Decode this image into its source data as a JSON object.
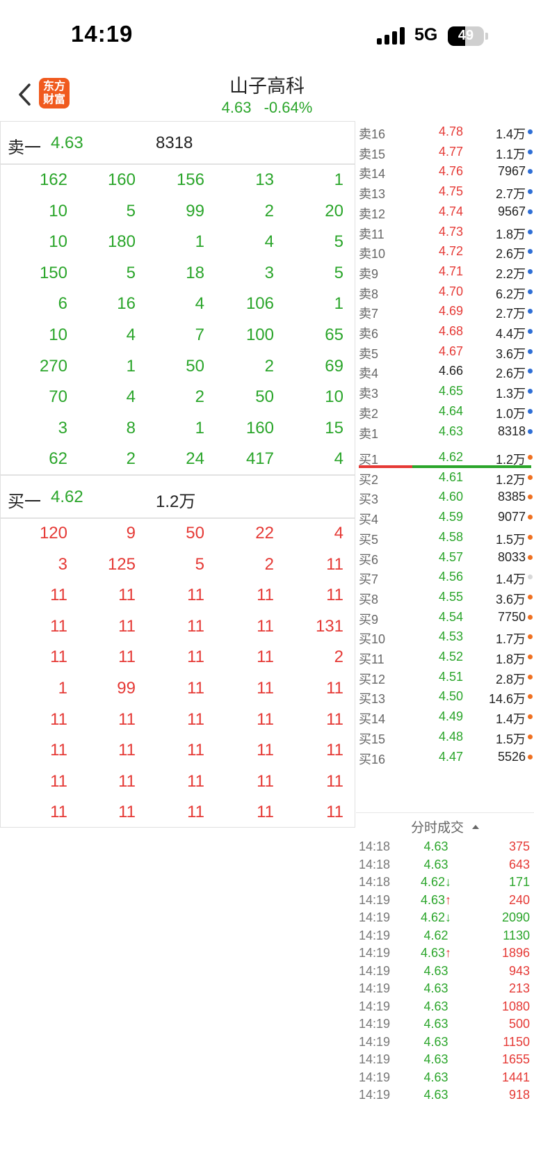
{
  "status_bar": {
    "time": "14:19",
    "network": "5G",
    "battery": "49",
    "battery_level": 0.49
  },
  "header": {
    "title": "山子高科",
    "price": "4.63",
    "change_pct": "-0.64%",
    "logo_line1": "东方",
    "logo_line2": "财富"
  },
  "left_panel": {
    "sell_level": {
      "label": "卖一",
      "price": "4.63",
      "volume": "8318"
    },
    "sell_queue": [
      [
        "162",
        "160",
        "156",
        "13",
        "1"
      ],
      [
        "10",
        "5",
        "99",
        "2",
        "20"
      ],
      [
        "10",
        "180",
        "1",
        "4",
        "5"
      ],
      [
        "150",
        "5",
        "18",
        "3",
        "5"
      ],
      [
        "6",
        "16",
        "4",
        "106",
        "1"
      ],
      [
        "10",
        "4",
        "7",
        "100",
        "65"
      ],
      [
        "270",
        "1",
        "50",
        "2",
        "69"
      ],
      [
        "70",
        "4",
        "2",
        "50",
        "10"
      ],
      [
        "3",
        "8",
        "1",
        "160",
        "15"
      ],
      [
        "62",
        "2",
        "24",
        "417",
        "4"
      ]
    ],
    "buy_level": {
      "label": "买一",
      "price": "4.62",
      "volume": "1.2万"
    },
    "buy_queue": [
      [
        "120",
        "9",
        "50",
        "22",
        "4"
      ],
      [
        "3",
        "125",
        "5",
        "2",
        "11"
      ],
      [
        "11",
        "11",
        "11",
        "11",
        "11"
      ],
      [
        "11",
        "11",
        "11",
        "11",
        "131"
      ],
      [
        "11",
        "11",
        "11",
        "11",
        "2"
      ],
      [
        "1",
        "99",
        "11",
        "11",
        "11"
      ],
      [
        "11",
        "11",
        "11",
        "11",
        "11"
      ],
      [
        "11",
        "11",
        "11",
        "11",
        "11"
      ],
      [
        "11",
        "11",
        "11",
        "11",
        "11"
      ],
      [
        "11",
        "11",
        "11",
        "11",
        "11"
      ]
    ]
  },
  "order_book": {
    "asks": [
      {
        "label": "卖16",
        "price": "4.78",
        "vol": "1.4万",
        "color": "red"
      },
      {
        "label": "卖15",
        "price": "4.77",
        "vol": "1.1万",
        "color": "red"
      },
      {
        "label": "卖14",
        "price": "4.76",
        "vol": "7967",
        "color": "red"
      },
      {
        "label": "卖13",
        "price": "4.75",
        "vol": "2.7万",
        "color": "red"
      },
      {
        "label": "卖12",
        "price": "4.74",
        "vol": "9567",
        "color": "red"
      },
      {
        "label": "卖11",
        "price": "4.73",
        "vol": "1.8万",
        "color": "red"
      },
      {
        "label": "卖10",
        "price": "4.72",
        "vol": "2.6万",
        "color": "red"
      },
      {
        "label": "卖9",
        "price": "4.71",
        "vol": "2.2万",
        "color": "red"
      },
      {
        "label": "卖8",
        "price": "4.70",
        "vol": "6.2万",
        "color": "red"
      },
      {
        "label": "卖7",
        "price": "4.69",
        "vol": "2.7万",
        "color": "red"
      },
      {
        "label": "卖6",
        "price": "4.68",
        "vol": "4.4万",
        "color": "red"
      },
      {
        "label": "卖5",
        "price": "4.67",
        "vol": "3.6万",
        "color": "red"
      },
      {
        "label": "卖4",
        "price": "4.66",
        "vol": "2.6万",
        "color": "dark"
      },
      {
        "label": "卖3",
        "price": "4.65",
        "vol": "1.3万",
        "color": "green"
      },
      {
        "label": "卖2",
        "price": "4.64",
        "vol": "1.0万",
        "color": "green"
      },
      {
        "label": "卖1",
        "price": "4.63",
        "vol": "8318",
        "color": "green"
      }
    ],
    "bids": [
      {
        "label": "买1",
        "price": "4.62",
        "vol": "1.2万",
        "dot": "orange"
      },
      {
        "label": "买2",
        "price": "4.61",
        "vol": "1.2万",
        "dot": "orange"
      },
      {
        "label": "买3",
        "price": "4.60",
        "vol": "8385",
        "dot": "orange"
      },
      {
        "label": "买4",
        "price": "4.59",
        "vol": "9077",
        "dot": "orange"
      },
      {
        "label": "买5",
        "price": "4.58",
        "vol": "1.5万",
        "dot": "orange"
      },
      {
        "label": "买6",
        "price": "4.57",
        "vol": "8033",
        "dot": "orange"
      },
      {
        "label": "买7",
        "price": "4.56",
        "vol": "1.4万",
        "dot": "light"
      },
      {
        "label": "买8",
        "price": "4.55",
        "vol": "3.6万",
        "dot": "orange"
      },
      {
        "label": "买9",
        "price": "4.54",
        "vol": "7750",
        "dot": "orange"
      },
      {
        "label": "买10",
        "price": "4.53",
        "vol": "1.7万",
        "dot": "orange"
      },
      {
        "label": "买11",
        "price": "4.52",
        "vol": "1.8万",
        "dot": "orange"
      },
      {
        "label": "买12",
        "price": "4.51",
        "vol": "2.8万",
        "dot": "orange"
      },
      {
        "label": "买13",
        "price": "4.50",
        "vol": "14.6万",
        "dot": "orange"
      },
      {
        "label": "买14",
        "price": "4.49",
        "vol": "1.4万",
        "dot": "orange"
      },
      {
        "label": "买15",
        "price": "4.48",
        "vol": "1.5万",
        "dot": "orange"
      },
      {
        "label": "买16",
        "price": "4.47",
        "vol": "5526",
        "dot": "orange"
      }
    ],
    "balance_red_fraction": 0.31
  },
  "ticks": {
    "header": "分时成交",
    "rows": [
      {
        "time": "14:18",
        "price": "4.63",
        "arrow": "",
        "vol": "375",
        "vol_color": "red"
      },
      {
        "time": "14:18",
        "price": "4.63",
        "arrow": "",
        "vol": "643",
        "vol_color": "red"
      },
      {
        "time": "14:18",
        "price": "4.62",
        "arrow": "↓",
        "vol": "171",
        "vol_color": "green"
      },
      {
        "time": "14:19",
        "price": "4.63",
        "arrow": "↑",
        "vol": "240",
        "vol_color": "red"
      },
      {
        "time": "14:19",
        "price": "4.62",
        "arrow": "↓",
        "vol": "2090",
        "vol_color": "green"
      },
      {
        "time": "14:19",
        "price": "4.62",
        "arrow": "",
        "vol": "1130",
        "vol_color": "green"
      },
      {
        "time": "14:19",
        "price": "4.63",
        "arrow": "↑",
        "vol": "1896",
        "vol_color": "red"
      },
      {
        "time": "14:19",
        "price": "4.63",
        "arrow": "",
        "vol": "943",
        "vol_color": "red"
      },
      {
        "time": "14:19",
        "price": "4.63",
        "arrow": "",
        "vol": "213",
        "vol_color": "red"
      },
      {
        "time": "14:19",
        "price": "4.63",
        "arrow": "",
        "vol": "1080",
        "vol_color": "red"
      },
      {
        "time": "14:19",
        "price": "4.63",
        "arrow": "",
        "vol": "500",
        "vol_color": "red"
      },
      {
        "time": "14:19",
        "price": "4.63",
        "arrow": "",
        "vol": "1150",
        "vol_color": "red"
      },
      {
        "time": "14:19",
        "price": "4.63",
        "arrow": "",
        "vol": "1655",
        "vol_color": "red"
      },
      {
        "time": "14:19",
        "price": "4.63",
        "arrow": "",
        "vol": "1441",
        "vol_color": "red"
      },
      {
        "time": "14:19",
        "price": "4.63",
        "arrow": "",
        "vol": "918",
        "vol_color": "red"
      }
    ]
  }
}
